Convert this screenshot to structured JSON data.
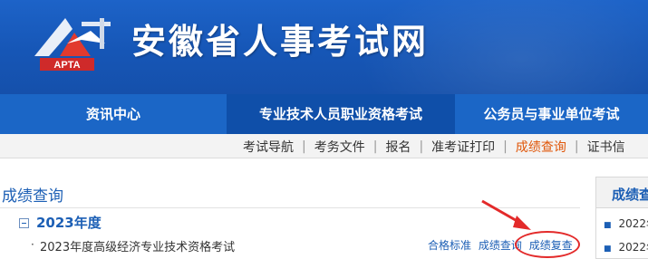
{
  "header": {
    "site_title": "安徽省人事考试网",
    "logo_text": "APTA"
  },
  "nav": {
    "items": [
      {
        "label": "资讯中心"
      },
      {
        "label": "专业技术人员职业资格考试"
      },
      {
        "label": "公务员与事业单位考试"
      }
    ]
  },
  "subnav": {
    "items": [
      {
        "label": "考试导航"
      },
      {
        "label": "考务文件"
      },
      {
        "label": "报名"
      },
      {
        "label": "准考证打印"
      },
      {
        "label": "成绩查询"
      },
      {
        "label": "证书信"
      }
    ],
    "active": "成绩查询"
  },
  "content": {
    "section_title": "成绩查询",
    "year": "2023年度",
    "exam": {
      "bullet": "·",
      "name": "2023年度高级经济专业技术资格考试",
      "links": [
        "合格标准",
        "成绩查询",
        "成绩复查"
      ]
    }
  },
  "sidebar": {
    "title": "成绩查",
    "items": [
      "2022年",
      "2022年"
    ]
  },
  "colors": {
    "header_blue": "#1656b6",
    "nav_active": "#0f4fa9",
    "link_blue": "#1c5fb5",
    "active_orange": "#e0570a",
    "annotation_red": "#e32a2a"
  }
}
